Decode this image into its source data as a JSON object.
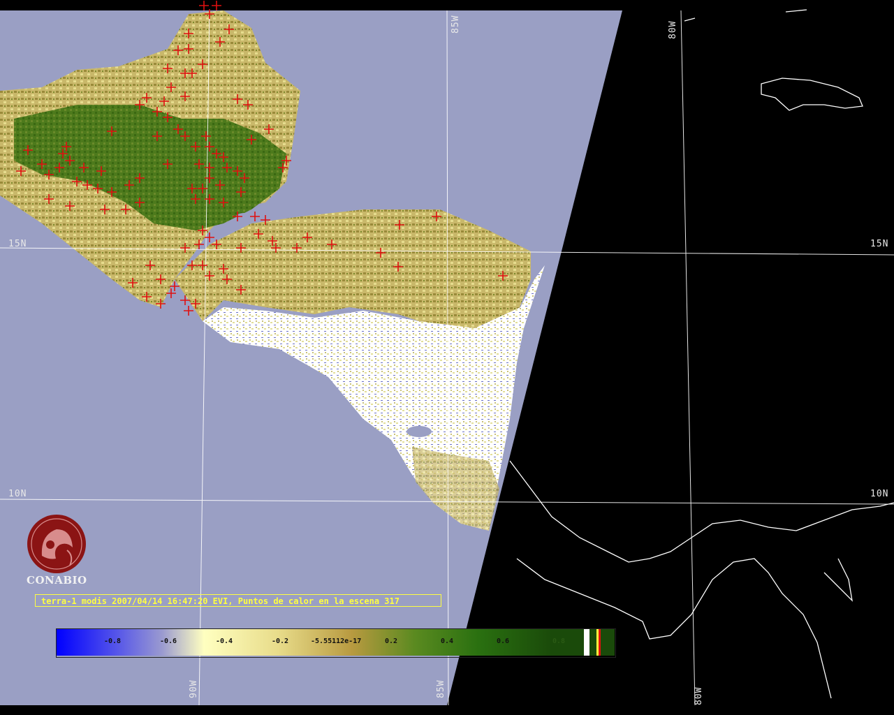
{
  "title": "terra-1 modis 2007/04/14 16:47:20 EVI, Puntos de calor en la escena 317",
  "logo": {
    "text": "CONABIO"
  },
  "grid": {
    "latitudes": [
      "15N",
      "10N"
    ],
    "longitudes": [
      "85W",
      "90W",
      "80W"
    ]
  },
  "colorbar": {
    "ticks": [
      "-0.8",
      "-0.6",
      "-0.4",
      "-0.2",
      "-5.55112e-17",
      "0.2",
      "0.4",
      "0.6",
      "0.8"
    ]
  },
  "colors": {
    "ocean": "#9a9fc4",
    "no_data": "#000000",
    "hotspot": "#e01010",
    "grid": "#ffffff",
    "caption": "#ffff40",
    "logo": "#8b1414"
  }
}
